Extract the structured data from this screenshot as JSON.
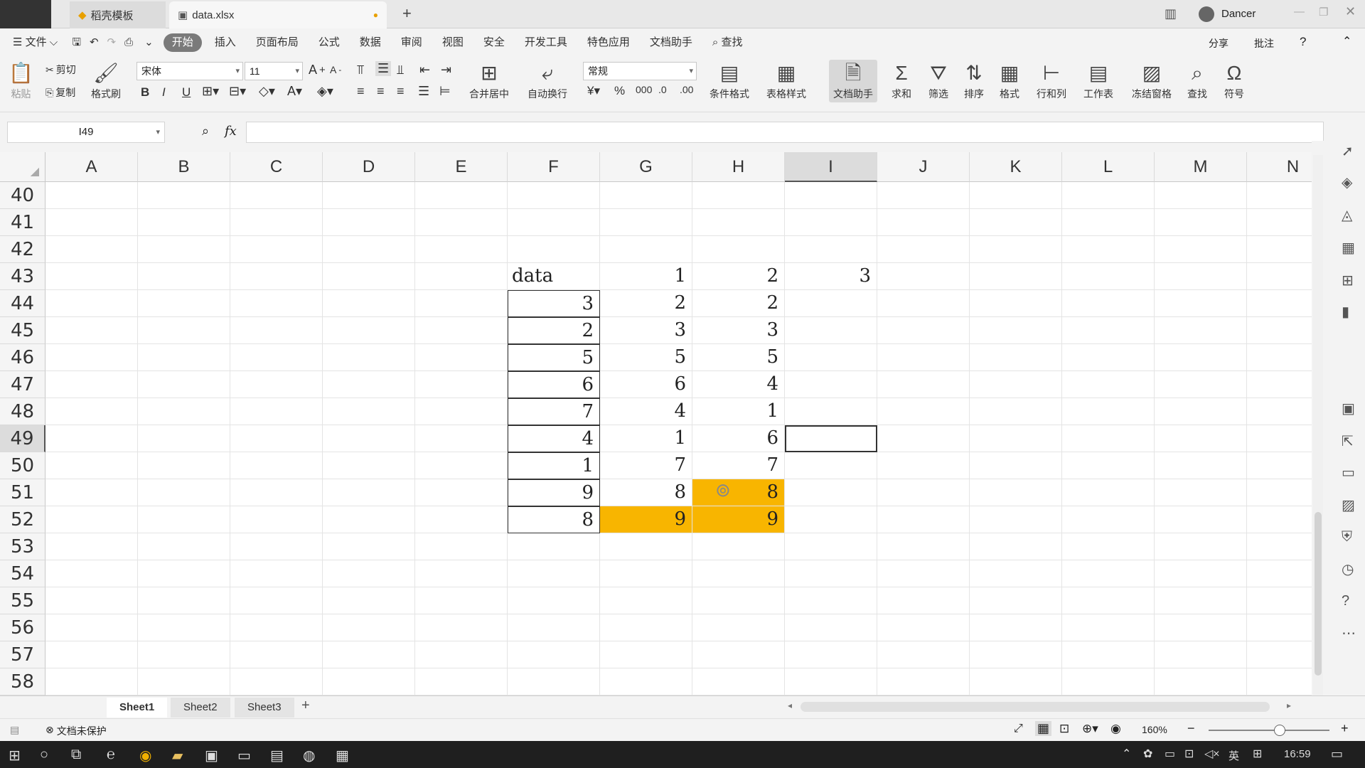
{
  "tabs": {
    "home_label": "稻壳模板",
    "file_label": "data.xlsx",
    "add": "+",
    "user": "Dancer"
  },
  "menu": [
    "文件",
    "开始",
    "插入",
    "页面布局",
    "公式",
    "数据",
    "审阅",
    "视图",
    "安全",
    "开发工具",
    "特色应用",
    "文档助手",
    "查找"
  ],
  "menu_right": {
    "share": "分享",
    "comment": "批注"
  },
  "ribbon": {
    "paste": "粘贴",
    "cut": "剪切",
    "copy": "复制",
    "format_painter": "格式刷",
    "font": "宋体",
    "font_size": "11",
    "merge": "合并居中",
    "wrap": "自动换行",
    "number_format": "常规",
    "cond_format": "条件格式",
    "table_style": "表格样式",
    "doc_helper": "文档助手",
    "sum": "求和",
    "filter": "筛选",
    "sort": "排序",
    "format": "格式",
    "rowcol": "行和列",
    "sheet": "工作表",
    "freeze": "冻结窗格",
    "find": "查找",
    "symbol": "符号"
  },
  "formula": {
    "name_box": "I49",
    "fx": "fx",
    "value": ""
  },
  "columns": [
    "A",
    "B",
    "C",
    "D",
    "E",
    "F",
    "G",
    "H",
    "I",
    "J",
    "K",
    "L",
    "M",
    "N"
  ],
  "rows": [
    "40",
    "41",
    "42",
    "43",
    "44",
    "45",
    "46",
    "47",
    "48",
    "49",
    "50",
    "51",
    "52",
    "53",
    "54",
    "55",
    "56",
    "57",
    "58"
  ],
  "cells": {
    "F43": "data",
    "G43": "1",
    "H43": "2",
    "I43": "3",
    "F44": "3",
    "G44": "2",
    "H44": "2",
    "F45": "2",
    "G45": "3",
    "H45": "3",
    "F46": "5",
    "G46": "5",
    "H46": "5",
    "F47": "6",
    "G47": "6",
    "H47": "4",
    "F48": "7",
    "G48": "4",
    "H48": "1",
    "F49": "4",
    "G49": "1",
    "H49": "6",
    "F50": "1",
    "G50": "7",
    "H50": "7",
    "F51": "9",
    "G51": "8",
    "H51": "8",
    "F52": "8",
    "G52": "9",
    "H52": "9"
  },
  "highlight_color": "#f8b500",
  "sheets": [
    "Sheet1",
    "Sheet2",
    "Sheet3"
  ],
  "status": {
    "protect": "文档未保护",
    "zoom": "160%"
  },
  "taskbar": {
    "time": "16:59",
    "ime": "英"
  }
}
